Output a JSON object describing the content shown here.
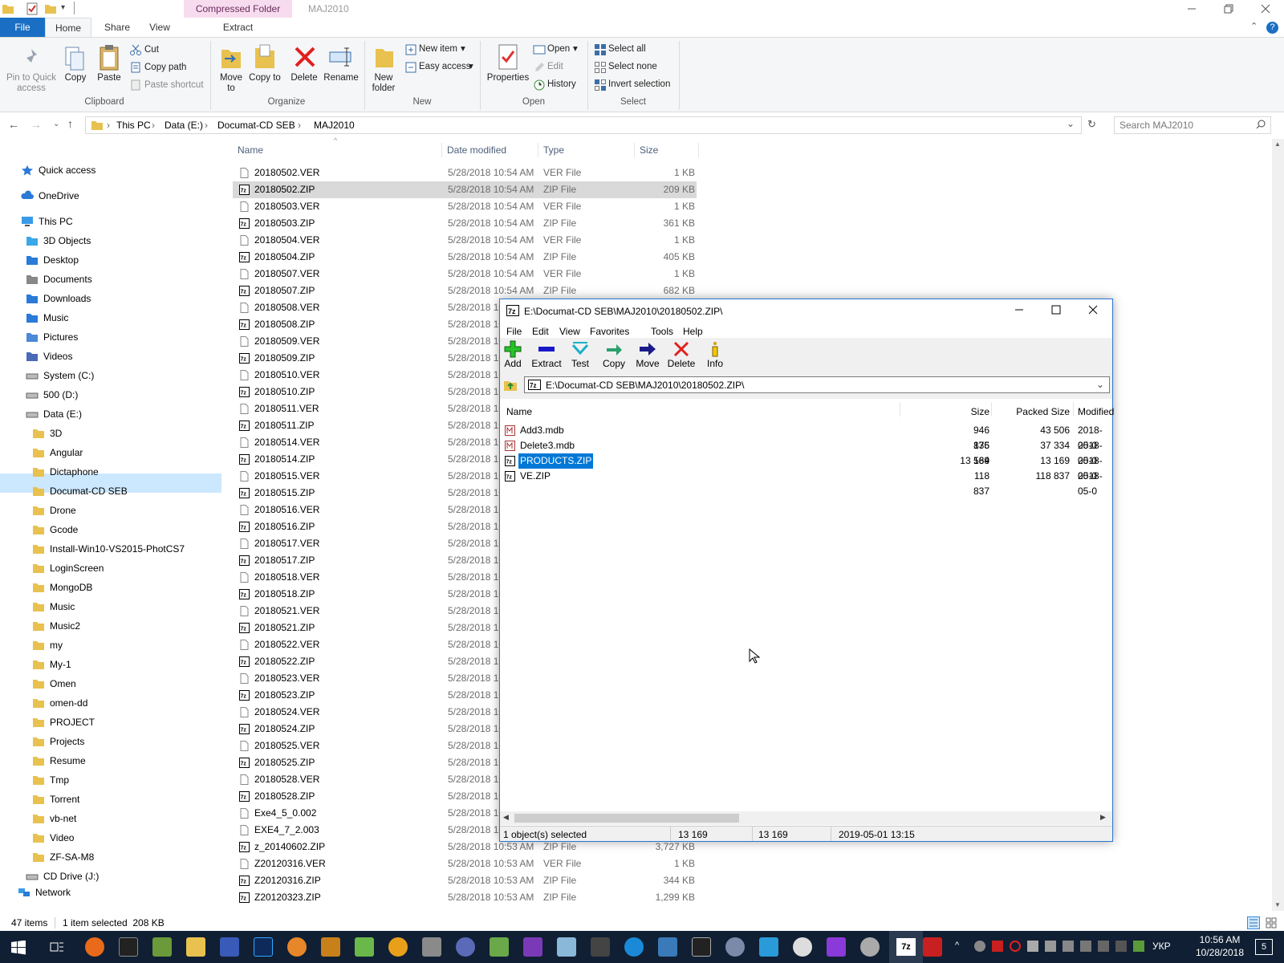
{
  "titlebar": {
    "context_tab": "Compressed Folder Tools",
    "window_title": "MAJ2010"
  },
  "ribbon_tabs": [
    "File",
    "Home",
    "Share",
    "View",
    "Extract"
  ],
  "ribbon": {
    "clipboard": {
      "pin_label": "Pin to Quick access",
      "copy_label": "Copy",
      "paste_label": "Paste",
      "cut_label": "Cut",
      "copy_path_label": "Copy path",
      "paste_shortcut_label": "Paste shortcut",
      "group_label": "Clipboard"
    },
    "organize": {
      "move_to_label": "Move to",
      "copy_to_label": "Copy to",
      "delete_label": "Delete",
      "rename_label": "Rename",
      "group_label": "Organize"
    },
    "new": {
      "new_folder_label": "New folder",
      "new_item_label": "New item",
      "easy_access_label": "Easy access",
      "group_label": "New"
    },
    "open": {
      "properties_label": "Properties",
      "open_label": "Open",
      "edit_label": "Edit",
      "history_label": "History",
      "group_label": "Open"
    },
    "select": {
      "select_all_label": "Select all",
      "select_none_label": "Select none",
      "invert_label": "Invert selection",
      "group_label": "Select"
    }
  },
  "address": {
    "crumbs": [
      "This PC",
      "Data (E:)",
      "Documat-CD SEB",
      "MAJ2010"
    ],
    "search_placeholder": "Search MAJ2010"
  },
  "nav": {
    "quick_access": "Quick access",
    "onedrive": "OneDrive",
    "this_pc": "This PC",
    "pc_items": [
      "3D Objects",
      "Desktop",
      "Documents",
      "Downloads",
      "Music",
      "Pictures",
      "Videos",
      "System (C:)",
      "500 (D:)",
      "Data (E:)"
    ],
    "folders": [
      "3D",
      "Angular",
      "Dictaphone",
      "Documat-CD SEB",
      "Drone",
      "Gcode",
      "Install-Win10-VS2015-PhotCS7",
      "LoginScreen",
      "MongoDB",
      "Music",
      "Music2",
      "my",
      "My-1",
      "Omen",
      "omen-dd",
      "PROJECT",
      "Projects",
      "Resume",
      "Tmp",
      "Torrent",
      "vb-net",
      "Video",
      "ZF-SA-M8"
    ],
    "cd_drive": "CD Drive (J:)",
    "network": "Network"
  },
  "list": {
    "headers": {
      "name": "Name",
      "date": "Date modified",
      "type": "Type",
      "size": "Size"
    },
    "rows": [
      {
        "name": "20180502.VER",
        "date": "5/28/2018 10:54 AM",
        "type": "VER File",
        "size": "1 KB",
        "zip": false
      },
      {
        "name": "20180502.ZIP",
        "date": "5/28/2018 10:54 AM",
        "type": "ZIP File",
        "size": "209 KB",
        "zip": true
      },
      {
        "name": "20180503.VER",
        "date": "5/28/2018 10:54 AM",
        "type": "VER File",
        "size": "1 KB",
        "zip": false
      },
      {
        "name": "20180503.ZIP",
        "date": "5/28/2018 10:54 AM",
        "type": "ZIP File",
        "size": "361 KB",
        "zip": true
      },
      {
        "name": "20180504.VER",
        "date": "5/28/2018 10:54 AM",
        "type": "VER File",
        "size": "1 KB",
        "zip": false
      },
      {
        "name": "20180504.ZIP",
        "date": "5/28/2018 10:54 AM",
        "type": "ZIP File",
        "size": "405 KB",
        "zip": true
      },
      {
        "name": "20180507.VER",
        "date": "5/28/2018 10:54 AM",
        "type": "VER File",
        "size": "1 KB",
        "zip": false
      },
      {
        "name": "20180507.ZIP",
        "date": "5/28/2018 10:54 AM",
        "type": "ZIP File",
        "size": "682 KB",
        "zip": true
      },
      {
        "name": "20180508.VER",
        "date": "5/28/2018 10",
        "type": "",
        "size": "",
        "zip": false
      },
      {
        "name": "20180508.ZIP",
        "date": "5/28/2018 10",
        "type": "",
        "size": "",
        "zip": true
      },
      {
        "name": "20180509.VER",
        "date": "5/28/2018 10",
        "type": "",
        "size": "",
        "zip": false
      },
      {
        "name": "20180509.ZIP",
        "date": "5/28/2018 10",
        "type": "",
        "size": "",
        "zip": true
      },
      {
        "name": "20180510.VER",
        "date": "5/28/2018 10",
        "type": "",
        "size": "",
        "zip": false
      },
      {
        "name": "20180510.ZIP",
        "date": "5/28/2018 10",
        "type": "",
        "size": "",
        "zip": true
      },
      {
        "name": "20180511.VER",
        "date": "5/28/2018 10",
        "type": "",
        "size": "",
        "zip": false
      },
      {
        "name": "20180511.ZIP",
        "date": "5/28/2018 10",
        "type": "",
        "size": "",
        "zip": true
      },
      {
        "name": "20180514.VER",
        "date": "5/28/2018 10",
        "type": "",
        "size": "",
        "zip": false
      },
      {
        "name": "20180514.ZIP",
        "date": "5/28/2018 10",
        "type": "",
        "size": "",
        "zip": true
      },
      {
        "name": "20180515.VER",
        "date": "5/28/2018 10",
        "type": "",
        "size": "",
        "zip": false
      },
      {
        "name": "20180515.ZIP",
        "date": "5/28/2018 10",
        "type": "",
        "size": "",
        "zip": true
      },
      {
        "name": "20180516.VER",
        "date": "5/28/2018 10",
        "type": "",
        "size": "",
        "zip": false
      },
      {
        "name": "20180516.ZIP",
        "date": "5/28/2018 10",
        "type": "",
        "size": "",
        "zip": true
      },
      {
        "name": "20180517.VER",
        "date": "5/28/2018 10",
        "type": "",
        "size": "",
        "zip": false
      },
      {
        "name": "20180517.ZIP",
        "date": "5/28/2018 10",
        "type": "",
        "size": "",
        "zip": true
      },
      {
        "name": "20180518.VER",
        "date": "5/28/2018 10",
        "type": "",
        "size": "",
        "zip": false
      },
      {
        "name": "20180518.ZIP",
        "date": "5/28/2018 10",
        "type": "",
        "size": "",
        "zip": true
      },
      {
        "name": "20180521.VER",
        "date": "5/28/2018 10",
        "type": "",
        "size": "",
        "zip": false
      },
      {
        "name": "20180521.ZIP",
        "date": "5/28/2018 10",
        "type": "",
        "size": "",
        "zip": true
      },
      {
        "name": "20180522.VER",
        "date": "5/28/2018 10",
        "type": "",
        "size": "",
        "zip": false
      },
      {
        "name": "20180522.ZIP",
        "date": "5/28/2018 10",
        "type": "",
        "size": "",
        "zip": true
      },
      {
        "name": "20180523.VER",
        "date": "5/28/2018 10",
        "type": "",
        "size": "",
        "zip": false
      },
      {
        "name": "20180523.ZIP",
        "date": "5/28/2018 10",
        "type": "",
        "size": "",
        "zip": true
      },
      {
        "name": "20180524.VER",
        "date": "5/28/2018 10",
        "type": "",
        "size": "",
        "zip": false
      },
      {
        "name": "20180524.ZIP",
        "date": "5/28/2018 10",
        "type": "",
        "size": "",
        "zip": true
      },
      {
        "name": "20180525.VER",
        "date": "5/28/2018 10",
        "type": "",
        "size": "",
        "zip": false
      },
      {
        "name": "20180525.ZIP",
        "date": "5/28/2018 10",
        "type": "",
        "size": "",
        "zip": true
      },
      {
        "name": "20180528.VER",
        "date": "5/28/2018 10",
        "type": "",
        "size": "",
        "zip": false
      },
      {
        "name": "20180528.ZIP",
        "date": "5/28/2018 10",
        "type": "",
        "size": "",
        "zip": true
      },
      {
        "name": "Exe4_5_0.002",
        "date": "5/28/2018 10",
        "type": "",
        "size": "",
        "zip": false
      },
      {
        "name": "EXE4_7_2.003",
        "date": "5/28/2018 10",
        "type": "",
        "size": "",
        "zip": false
      },
      {
        "name": "z_20140602.ZIP",
        "date": "5/28/2018 10:53 AM",
        "type": "ZIP File",
        "size": "3,727 KB",
        "zip": true
      },
      {
        "name": "Z20120316.VER",
        "date": "5/28/2018 10:53 AM",
        "type": "VER File",
        "size": "1 KB",
        "zip": false
      },
      {
        "name": "Z20120316.ZIP",
        "date": "5/28/2018 10:53 AM",
        "type": "ZIP File",
        "size": "344 KB",
        "zip": true
      },
      {
        "name": "Z20120323.ZIP",
        "date": "5/28/2018 10:53 AM",
        "type": "ZIP File",
        "size": "1,299 KB",
        "zip": true
      }
    ]
  },
  "status": {
    "count": "47 items",
    "selected": "1 item selected  208 KB"
  },
  "zip_window": {
    "title": "E:\\Documat-CD SEB\\MAJ2010\\20180502.ZIP\\",
    "menu": [
      "File",
      "Edit",
      "View",
      "Favorites",
      "Tools",
      "Help"
    ],
    "toolbar": [
      "Add",
      "Extract",
      "Test",
      "Copy",
      "Move",
      "Delete",
      "Info"
    ],
    "path": "E:\\Documat-CD SEB\\MAJ2010\\20180502.ZIP\\",
    "headers": {
      "name": "Name",
      "size": "Size",
      "packed": "Packed Size",
      "modified": "Modified"
    },
    "rows": [
      {
        "name": "Add3.mdb",
        "size": "946 176",
        "packed": "43 506",
        "modified": "2018-05-0"
      },
      {
        "name": "Delete3.mdb",
        "size": "835 584",
        "packed": "37 334",
        "modified": "2018-05-0"
      },
      {
        "name": "PRODUCTS.ZIP",
        "size": "13 169",
        "packed": "13 169",
        "modified": "2018-05-0"
      },
      {
        "name": "VE.ZIP",
        "size": "118 837",
        "packed": "118 837",
        "modified": "2018-05-0"
      }
    ],
    "status": {
      "selected": "1 object(s) selected",
      "size": "13 169",
      "packed": "13 169",
      "date": "2019-05-01 13:15"
    }
  },
  "taskbar": {
    "lang": "УКР",
    "time": "10:56 AM",
    "date": "10/28/2018",
    "notif_count": "5"
  },
  "colors": {
    "accent": "#1a6fc4",
    "context_tab": "#f7dcef",
    "selection": "#cce8ff",
    "taskbar": "#101f33"
  }
}
